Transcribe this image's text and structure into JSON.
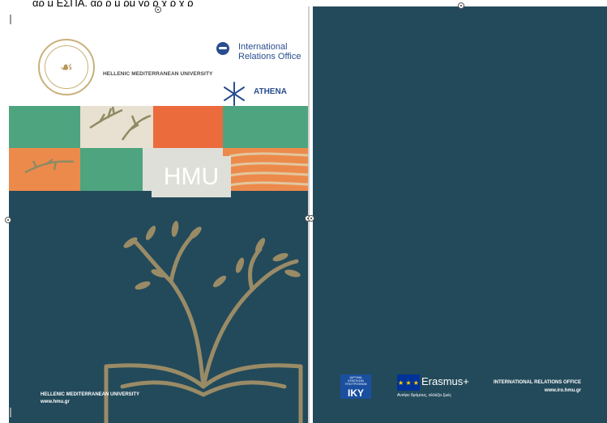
{
  "top_strip": {
    "text": "αρ μ ΕΣΠΑ, αρ ρ μ ρμ γρ ρ χ ρ χ ρ"
  },
  "left_page": {
    "university_name": "HELLENIC MEDITERRANEAN UNIVERSITY",
    "iro_logo_text": "International Relations Office",
    "athena_label": "ATHENA",
    "hmu_label": "HMU",
    "footer_name": "HELLENIC MEDITERRANEAN UNIVERSITY",
    "footer_url": "www.hmu.gr",
    "seal_glyph": "☙"
  },
  "right_page": {
    "iky_top": "ΙΔΡΥΜΑ ΚΡΑΤΙΚΩΝ ΥΠΟΤΡΟΦΙΩΝ",
    "iky_label": "IKY",
    "erasmus_label": "Erasmus+",
    "erasmus_subtitle": "Ανοίγει δρόμους, αλλάζει ζωές",
    "footer_office": "INTERNATIONAL RELATIONS OFFICE",
    "footer_url": "www.iro.hmu.gr",
    "eu_stars": "★ ★ ★"
  },
  "colors": {
    "green": "#4ea47f",
    "orange": "#ec6b3c",
    "beige": "#e8e0d0",
    "teal": "#234a5a",
    "gold": "#9a8b67"
  }
}
